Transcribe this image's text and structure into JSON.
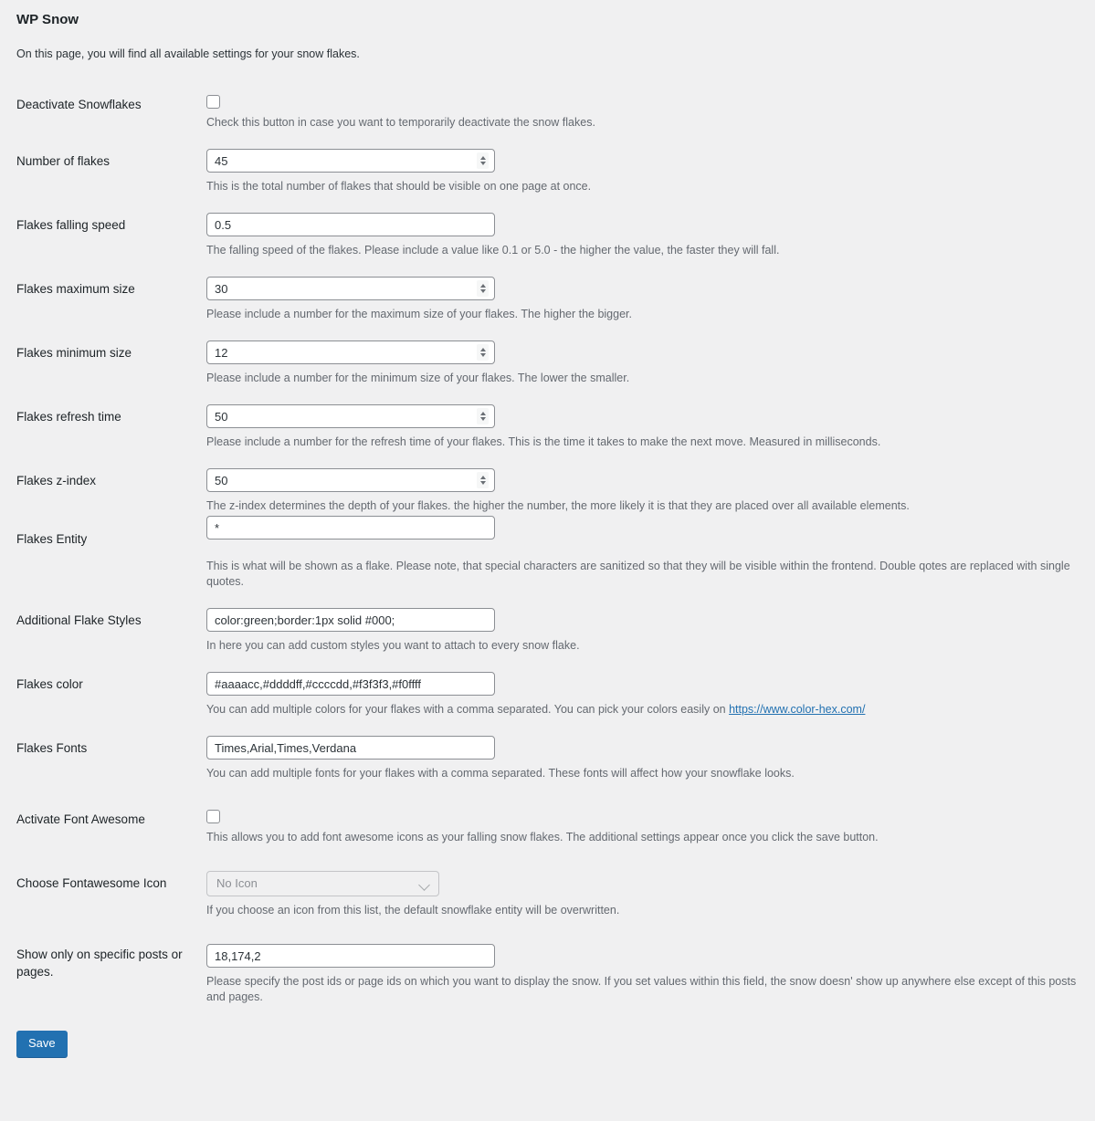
{
  "page": {
    "title": "WP Snow",
    "intro": "On this page, you will find all available settings for your snow flakes."
  },
  "fields": [
    {
      "label": "Deactivate Snowflakes",
      "type": "checkbox",
      "checked": false,
      "name": "deactivate-snowflakes",
      "description": "Check this button in case you want to temporarily deactivate the snow flakes."
    },
    {
      "label": "Number of flakes",
      "type": "number",
      "value": "45",
      "name": "number-of-flakes",
      "description": "This is the total number of flakes that should be visible on one page at once."
    },
    {
      "label": "Flakes falling speed",
      "type": "text",
      "value": "0.5",
      "name": "flakes-falling-speed",
      "description": "The falling speed of the flakes. Please include a value like 0.1 or 5.0 - the higher the value, the faster they will fall."
    },
    {
      "label": "Flakes maximum size",
      "type": "number",
      "value": "30",
      "name": "flakes-maximum-size",
      "description": "Please include a number for the maximum size of your flakes. The higher the bigger."
    },
    {
      "label": "Flakes minimum size",
      "type": "number",
      "value": "12",
      "name": "flakes-minimum-size",
      "description": "Please include a number for the minimum size of your flakes. The lower the smaller."
    },
    {
      "label": "Flakes refresh time",
      "type": "number",
      "value": "50",
      "name": "flakes-refresh-time",
      "description": "Please include a number for the refresh time of your flakes. This is the time it takes to make the next move. Measured in milliseconds."
    },
    {
      "label": "Flakes z-index",
      "type": "number",
      "value": "50",
      "name": "flakes-z-index",
      "description": "The z-index determines the depth of your flakes. the higher the number, the more likely it is that they are placed over all available elements."
    },
    {
      "label": "Flakes Entity",
      "type": "text-clipped",
      "value": "*",
      "name": "flakes-entity",
      "description": "This is what will be shown as a flake. Please note, that special characters are sanitized so that they will be visible within the frontend. Double qotes are replaced with single quotes."
    },
    {
      "label": "Additional Flake Styles",
      "type": "text",
      "value": "color:green;border:1px solid #000;",
      "name": "additional-flake-styles",
      "description": "In here you can add custom styles you want to attach to every snow flake."
    },
    {
      "label": "Flakes color",
      "type": "text",
      "value": "#aaaacc,#ddddff,#ccccdd,#f3f3f3,#f0ffff",
      "name": "flakes-color",
      "description_before": "You can add multiple colors for your flakes with a comma separated. You can pick your colors easily on ",
      "link_text": "https://www.color-hex.com/"
    },
    {
      "label": "Flakes Fonts",
      "type": "text",
      "value": "Times,Arial,Times,Verdana",
      "name": "flakes-fonts",
      "description": "You can add multiple fonts for your flakes with a comma separated. These fonts will affect how your snowflake looks."
    },
    {
      "label": "Activate Font Awesome",
      "type": "checkbox",
      "checked": false,
      "name": "activate-font-awesome",
      "description": "This allows you to add font awesome icons as your falling snow flakes. The additional settings appear once you click the save button."
    },
    {
      "label": "Choose Fontawesome Icon",
      "type": "select",
      "value": "No Icon",
      "name": "choose-fontawesome-icon",
      "disabled": true,
      "description": "If you choose an icon from this list, the default snowflake entity will be overwritten."
    },
    {
      "label": "Show only on specific posts or pages.",
      "type": "text",
      "value": "18,174,2",
      "name": "show-only-on-specific-posts",
      "description": "Please specify the post ids or page ids on which you want to display the snow. If you set values within this field, the snow doesn' show up anywhere else except of this posts and pages."
    }
  ],
  "submit": {
    "save_label": "Save"
  },
  "colors": {
    "accent": "#2271b1",
    "page_bg": "#f0f0f1",
    "text": "#1d2327",
    "muted": "#646970"
  }
}
